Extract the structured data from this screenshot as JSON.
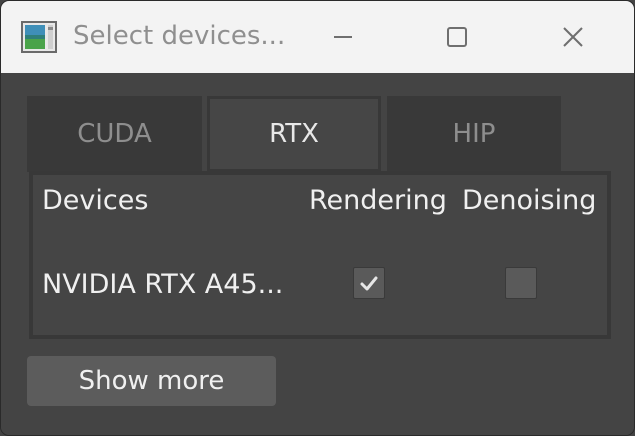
{
  "window": {
    "title": "Select devices...",
    "minimize_icon": "minimize-icon",
    "maximize_icon": "maximize-icon",
    "close_icon": "close-icon"
  },
  "tabs": [
    {
      "label": "CUDA",
      "active": false
    },
    {
      "label": "RTX",
      "active": true
    },
    {
      "label": "HIP",
      "active": false
    }
  ],
  "table": {
    "headers": [
      "Devices",
      "Rendering",
      "Denoising"
    ],
    "rows": [
      {
        "device": "NVIDIA RTX A45...",
        "rendering": true,
        "denoising": false
      }
    ]
  },
  "buttons": {
    "show_more": "Show more"
  },
  "colors": {
    "background": "#444444",
    "titlebar": "#f3f3f3",
    "panel_border": "#383838",
    "button": "#5c5c5c"
  }
}
